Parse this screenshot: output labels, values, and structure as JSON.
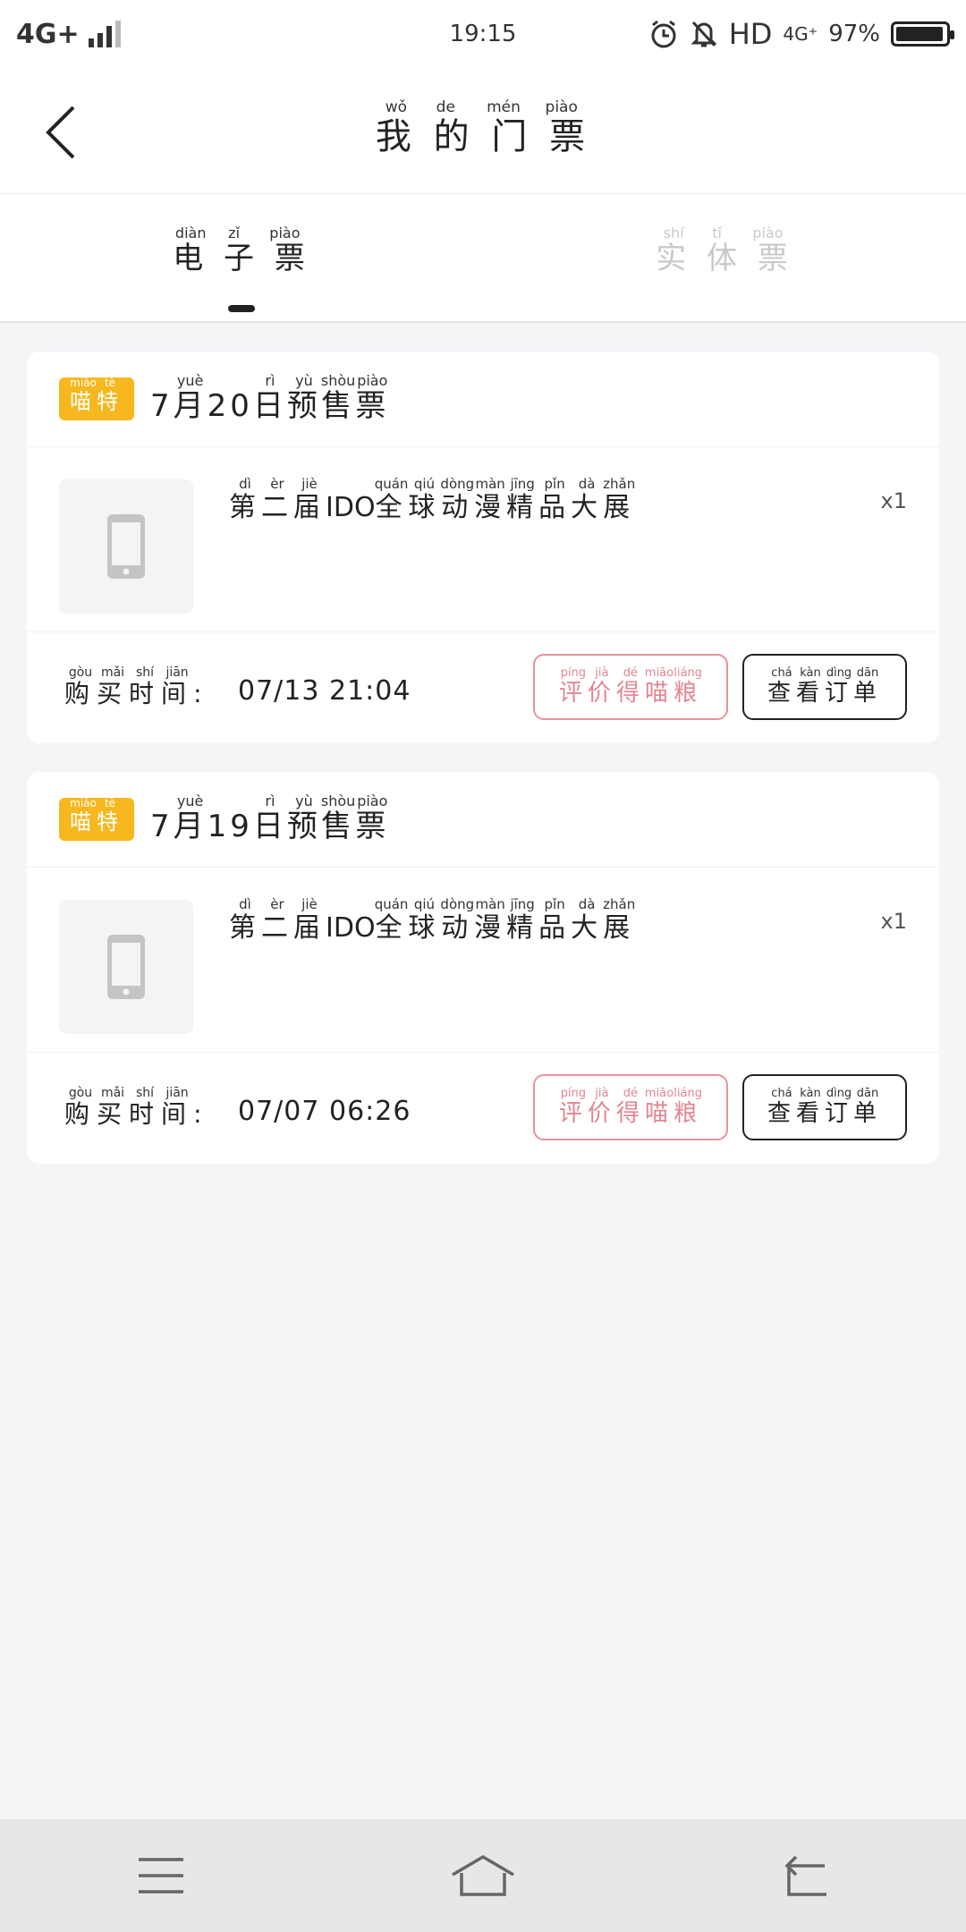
{
  "status_bar": {
    "network": "4G+",
    "time": "19:15",
    "hd": "HD",
    "data": "4G⁺",
    "battery": "97%"
  },
  "header": {
    "title_chars": [
      "我",
      "的",
      "门",
      "票"
    ],
    "title_pinyin": [
      "wǒ",
      "de",
      "mén",
      "piào"
    ]
  },
  "tabs": [
    {
      "chars": [
        "电",
        "子",
        "票"
      ],
      "pinyin": [
        "diàn",
        "zǐ",
        "piào"
      ],
      "active": true
    },
    {
      "chars": [
        "实",
        "体",
        "票"
      ],
      "pinyin": [
        "shí",
        "tǐ",
        "piào"
      ],
      "active": false
    }
  ],
  "labels": {
    "badge_chars": [
      "喵",
      "特"
    ],
    "badge_pinyin": [
      "miāo",
      "tè"
    ],
    "purchase_chars": [
      "购",
      "买",
      "时",
      "间"
    ],
    "purchase_pinyin": [
      "gòu",
      "mǎi",
      "shí",
      "jiān"
    ],
    "colon": ":",
    "review_chars": [
      "评",
      "价",
      "得",
      "喵",
      "粮"
    ],
    "review_pinyin": [
      "píng",
      "jià",
      "dé",
      "miāo",
      "liáng"
    ],
    "order_chars": [
      "查",
      "看",
      "订",
      "单"
    ],
    "order_pinyin": [
      "chá",
      "kàn",
      "dìng",
      "dān"
    ]
  },
  "tickets": [
    {
      "month": "7",
      "day": "20",
      "date_chars": [
        "月",
        "日",
        "预",
        "售",
        "票"
      ],
      "date_pinyin": [
        "yuè",
        "rì",
        "yù",
        "shòu",
        "piào"
      ],
      "event_prefix_chars": [
        "第",
        "二",
        "届"
      ],
      "event_prefix_pinyin": [
        "dì",
        "èr",
        "jiè"
      ],
      "event_code": "IDO",
      "event_suffix_chars": [
        "全",
        "球",
        "动",
        "漫",
        "精",
        "品",
        "大",
        "展"
      ],
      "event_suffix_pinyin": [
        "quán",
        "qiú",
        "dòng",
        "màn",
        "jīng",
        "pǐn",
        "dà",
        "zhǎn"
      ],
      "quantity": "x1",
      "purchase_time": "07/13 21:04"
    },
    {
      "month": "7",
      "day": "19",
      "date_chars": [
        "月",
        "日",
        "预",
        "售",
        "票"
      ],
      "date_pinyin": [
        "yuè",
        "rì",
        "yù",
        "shòu",
        "piào"
      ],
      "event_prefix_chars": [
        "第",
        "二",
        "届"
      ],
      "event_prefix_pinyin": [
        "dì",
        "èr",
        "jiè"
      ],
      "event_code": "IDO",
      "event_suffix_chars": [
        "全",
        "球",
        "动",
        "漫",
        "精",
        "品",
        "大",
        "展"
      ],
      "event_suffix_pinyin": [
        "quán",
        "qiú",
        "dòng",
        "màn",
        "jīng",
        "pǐn",
        "dà",
        "zhǎn"
      ],
      "quantity": "x1",
      "purchase_time": "07/07 06:26"
    }
  ],
  "icons": {
    "back": "back-arrow-icon",
    "alarm": "alarm-icon",
    "mute": "bell-off-icon",
    "thumb": "phone-placeholder-icon",
    "menu": "menu-icon",
    "home": "home-icon",
    "return": "return-icon"
  },
  "colors": {
    "badge": "#f6b81e",
    "review_border": "#e7929a",
    "background": "#f4f5f7"
  }
}
